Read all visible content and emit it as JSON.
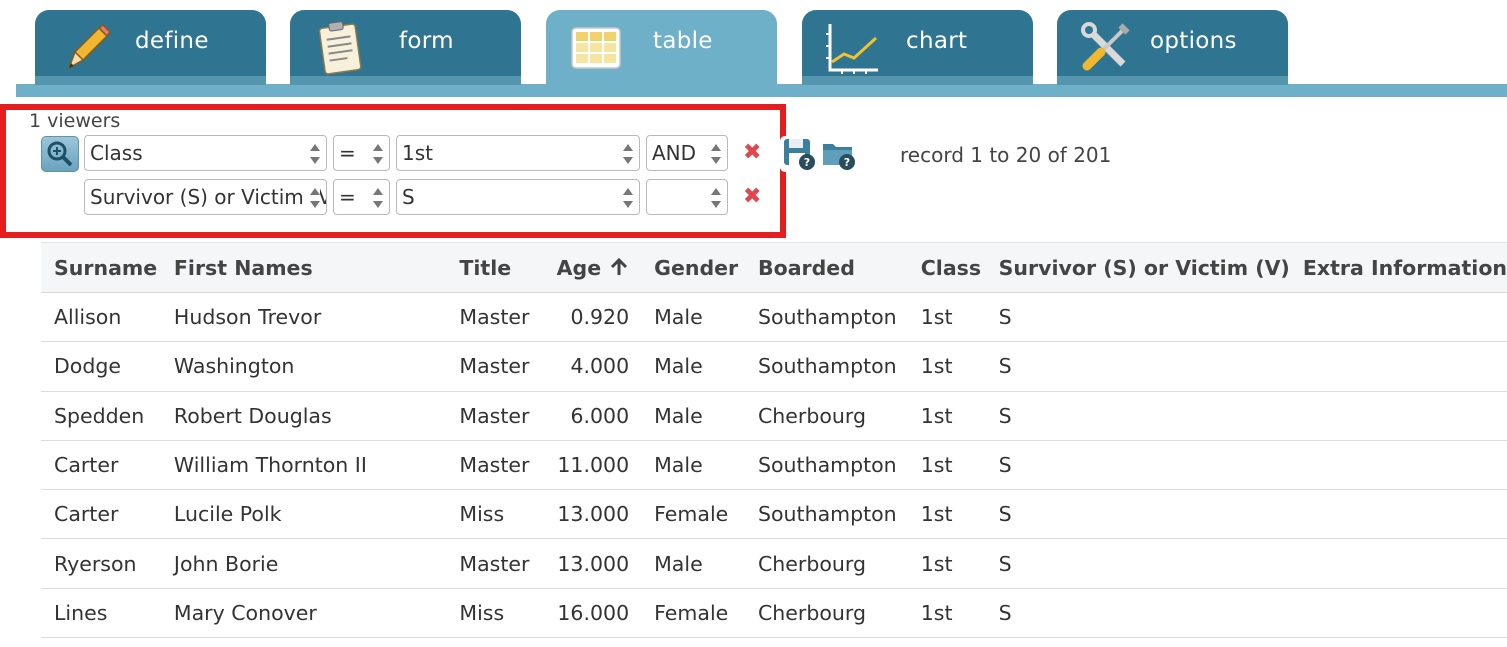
{
  "tabs": [
    {
      "label": "define",
      "icon": "pencil-icon",
      "active": false
    },
    {
      "label": "form",
      "icon": "clipboard-icon",
      "active": false
    },
    {
      "label": "table",
      "icon": "table-grid-icon",
      "active": true
    },
    {
      "label": "chart",
      "icon": "line-chart-icon",
      "active": false
    },
    {
      "label": "options",
      "icon": "wrench-screwdriver-icon",
      "active": false
    }
  ],
  "filter": {
    "viewers": "1 viewers",
    "rows": [
      {
        "field": "Class",
        "operator": "=",
        "value": "1st",
        "logic": "AND"
      },
      {
        "field": "Survivor (S) or Victim (V)",
        "operator": "=",
        "value": "S",
        "logic": ""
      }
    ],
    "record_count": "record 1 to 20 of 201"
  },
  "table": {
    "columns": [
      "Surname",
      "First Names",
      "Title",
      "Age",
      "Gender",
      "Boarded",
      "Class",
      "Survivor (S) or Victim (V)",
      "Extra Information"
    ],
    "sorted_column": "Age",
    "rows": [
      [
        "Allison",
        "Hudson Trevor",
        "Master",
        "0.920",
        "Male",
        "Southampton",
        "1st",
        "S",
        ""
      ],
      [
        "Dodge",
        "Washington",
        "Master",
        "4.000",
        "Male",
        "Southampton",
        "1st",
        "S",
        ""
      ],
      [
        "Spedden",
        "Robert Douglas",
        "Master",
        "6.000",
        "Male",
        "Cherbourg",
        "1st",
        "S",
        ""
      ],
      [
        "Carter",
        "William Thornton II",
        "Master",
        "11.000",
        "Male",
        "Southampton",
        "1st",
        "S",
        ""
      ],
      [
        "Carter",
        "Lucile Polk",
        "Miss",
        "13.000",
        "Female",
        "Southampton",
        "1st",
        "S",
        ""
      ],
      [
        "Ryerson",
        "John Borie",
        "Master",
        "13.000",
        "Male",
        "Cherbourg",
        "1st",
        "S",
        ""
      ],
      [
        "Lines",
        "Mary Conover",
        "Miss",
        "16.000",
        "Female",
        "Cherbourg",
        "1st",
        "S",
        ""
      ]
    ]
  },
  "colors": {
    "tab": "#2f7592",
    "tab_active": "#6fb0c9",
    "highlight_box": "#e41e1e",
    "remove": "#e0474c"
  }
}
